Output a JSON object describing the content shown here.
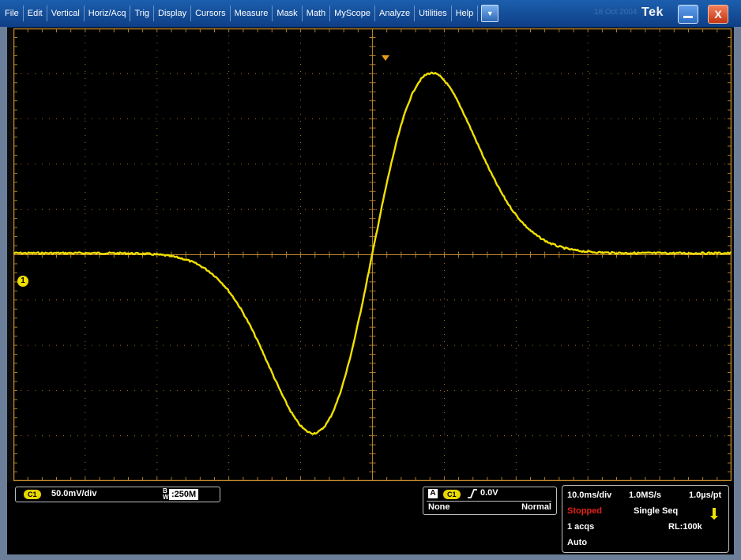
{
  "menubar": {
    "items": [
      "File",
      "Edit",
      "Vertical",
      "Horiz/Acq",
      "Trig",
      "Display",
      "Cursors",
      "Measure",
      "Mask",
      "Math",
      "MyScope",
      "Analyze",
      "Utilities",
      "Help"
    ],
    "ghost_date": "18 Oct 2004",
    "brand": "Tek",
    "close_label": "X",
    "dropdown_icon": "chevron-down-icon"
  },
  "display": {
    "trace_color": "#f1e000",
    "grid_color": "#c48a2c",
    "ch1_marker_label": "1",
    "waveform_description": "single-period gaussian doublet: negative lobe then positive lobe, crossing zero at trigger"
  },
  "channel1": {
    "badge": "C1",
    "scale": "50.0mV/div",
    "bandwidth_prefix": "B",
    "bandwidth_sub": "W",
    "bandwidth": ":250M"
  },
  "trigger": {
    "source_letter": "A",
    "badge": "C1",
    "level": "0.0V",
    "coupling": "None",
    "mode": "Normal"
  },
  "acquisition": {
    "time_per_div": "10.0ms/div",
    "sample_rate": "1.0MS/s",
    "resolution": "1.0µs/pt",
    "state": "Stopped",
    "run_mode": "Single Seq",
    "acq_count": "1 acqs",
    "record_length": "RL:100k",
    "trigger_mode": "Auto"
  }
}
